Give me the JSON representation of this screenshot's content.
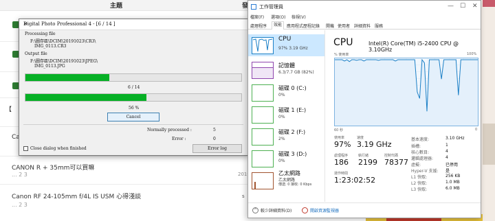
{
  "forum": {
    "header_topic": "主題",
    "header_right": "發",
    "posts": [
      {
        "title": "【",
        "sub": ""
      },
      {
        "title": "Car",
        "sub": ""
      },
      {
        "title": "CANON R + 35mm可以買嘛",
        "sub": "...  2  3",
        "date": "2019"
      },
      {
        "title": "Canon RF 24-105mm f/4L IS USM 心得淺談",
        "sub": "...  2  3",
        "date": "",
        "s": "s"
      }
    ]
  },
  "dpp": {
    "title": "Digital Photo Professional 4 - [6 / 14 ]",
    "close": "✕",
    "processing_label": "Processing file",
    "processing_path": "F:\\圖存區\\DCIM\\20191023\\CR3\\",
    "processing_file": "IMG_0113.CR3",
    "output_label": "Output file",
    "output_path": "F:\\圖存區\\DCIM\\20191023\\JPEG\\",
    "output_file": "IMG_0113.JPG",
    "file_progress": 0.39,
    "count_text": "6 / 14",
    "total_progress": 0.56,
    "percent_text": "56 %",
    "cancel_label": "Cancel",
    "normally_label": "Normally processed :",
    "normally_value": "5",
    "error_label": "Error :",
    "error_value": "0",
    "close_checkbox_label": "Close dialog when finished",
    "error_log_label": "Error log"
  },
  "tm": {
    "title": "工作管理員",
    "menu": [
      "檔案(F)",
      "選項(O)",
      "檢視(V)"
    ],
    "tabs": [
      "處理程序",
      "效能",
      "應用程式歷程記錄",
      "開機",
      "使用者",
      "詳細資料",
      "服務"
    ],
    "active_tab": "效能",
    "sidebar": [
      {
        "name": "CPU",
        "value": "97%  3.19 GHz"
      },
      {
        "name": "記憶體",
        "value": "6.3/7.7 GB (82%)"
      },
      {
        "name": "磁碟 0 (C:)",
        "value": "0%"
      },
      {
        "name": "磁碟 1 (E:)",
        "value": "0%"
      },
      {
        "name": "磁碟 2 (F:)",
        "value": "2%"
      },
      {
        "name": "磁碟 3 (D:)",
        "value": "0%"
      },
      {
        "name": "乙太網路",
        "value": "乙太網路",
        "value2": "傳送: 0  接收: 0 Kbps"
      }
    ],
    "cpu_title": "CPU",
    "cpu_model": "Intel(R) Core(TM) i5-2400 CPU @ 3.10GHz",
    "graph_label_left": "% 使用率",
    "graph_label_right": "100%",
    "graph_time_label": "60 秒",
    "graph_zero_label": "0",
    "usage": [
      100,
      100,
      100,
      100,
      98,
      100,
      97,
      100,
      100,
      99,
      100,
      100,
      98,
      100,
      100,
      100,
      100,
      100,
      99,
      100,
      100,
      100,
      100,
      100,
      100,
      98,
      100,
      100,
      100,
      100,
      100,
      100,
      100,
      100,
      50,
      40,
      100,
      95,
      20,
      100,
      100,
      100,
      100,
      100,
      70,
      100,
      100,
      100,
      100,
      100,
      100,
      45,
      100,
      100,
      100,
      100,
      100,
      100,
      100,
      100
    ],
    "stats": {
      "usage_label": "使用率",
      "usage_value": "97%",
      "speed_label": "速度",
      "speed_value": "3.19 GHz",
      "proc_label": "處理程序",
      "proc_value": "186",
      "thread_label": "執行緒",
      "thread_value": "2199",
      "handle_label": "控制代碼",
      "handle_value": "78377",
      "uptime_label": "運作時間",
      "uptime_value": "1:23:02:52"
    },
    "specs": [
      {
        "label": "基本速度:",
        "value": "3.10 GHz"
      },
      {
        "label": "插槽:",
        "value": "1"
      },
      {
        "label": "核心數目:",
        "value": "4"
      },
      {
        "label": "邏輯處理器:",
        "value": "4"
      },
      {
        "label": "虛擬:",
        "value": "已停用"
      },
      {
        "label": "Hyper-V 支援:",
        "value": "是"
      },
      {
        "label": "L1 快取:",
        "value": "256 KB"
      },
      {
        "label": "L2 快取:",
        "value": "1.0 MB"
      },
      {
        "label": "L3 快取:",
        "value": "6.0 MB"
      }
    ],
    "footer_less": "較少詳細資料(D)",
    "footer_monitor": "開啟資源監視器"
  }
}
